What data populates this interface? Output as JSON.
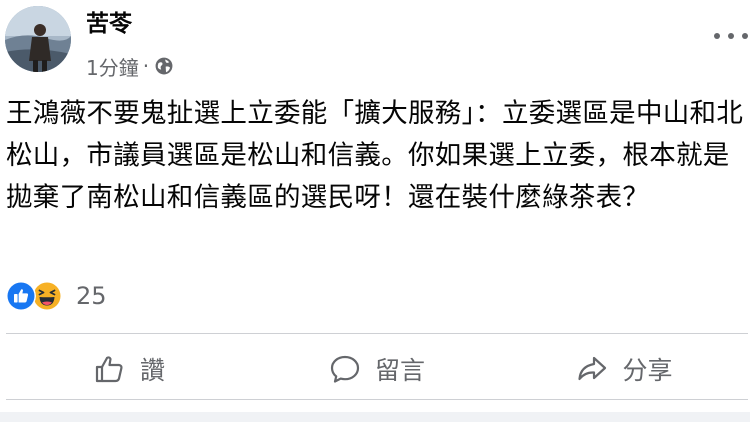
{
  "post": {
    "author": "苦苓",
    "time": "1分鐘",
    "meta_separator": "·",
    "privacy_icon": "globe-icon",
    "more_icon": "more-options-icon",
    "text": "王鴻薇不要鬼扯選上立委能「擴大服務」：立委選區是中山和北松山，市議員選區是松山和信義。你如果選上立委，根本就是拋棄了南松山和信義區的選民呀！還在裝什麼綠茶表？"
  },
  "reactions": {
    "icons": [
      "like-reaction-icon",
      "haha-reaction-icon"
    ],
    "count": "25"
  },
  "actions": {
    "like": {
      "label": "讚",
      "icon": "thumbs-up-icon"
    },
    "comment": {
      "label": "留言",
      "icon": "comment-bubble-icon"
    },
    "share": {
      "label": "分享",
      "icon": "share-arrow-icon"
    }
  },
  "colors": {
    "text": "#050505",
    "secondary": "#65676b",
    "like_blue": "#1877f2",
    "haha_yellow": "#f7b125",
    "divider": "#ced0d4"
  }
}
